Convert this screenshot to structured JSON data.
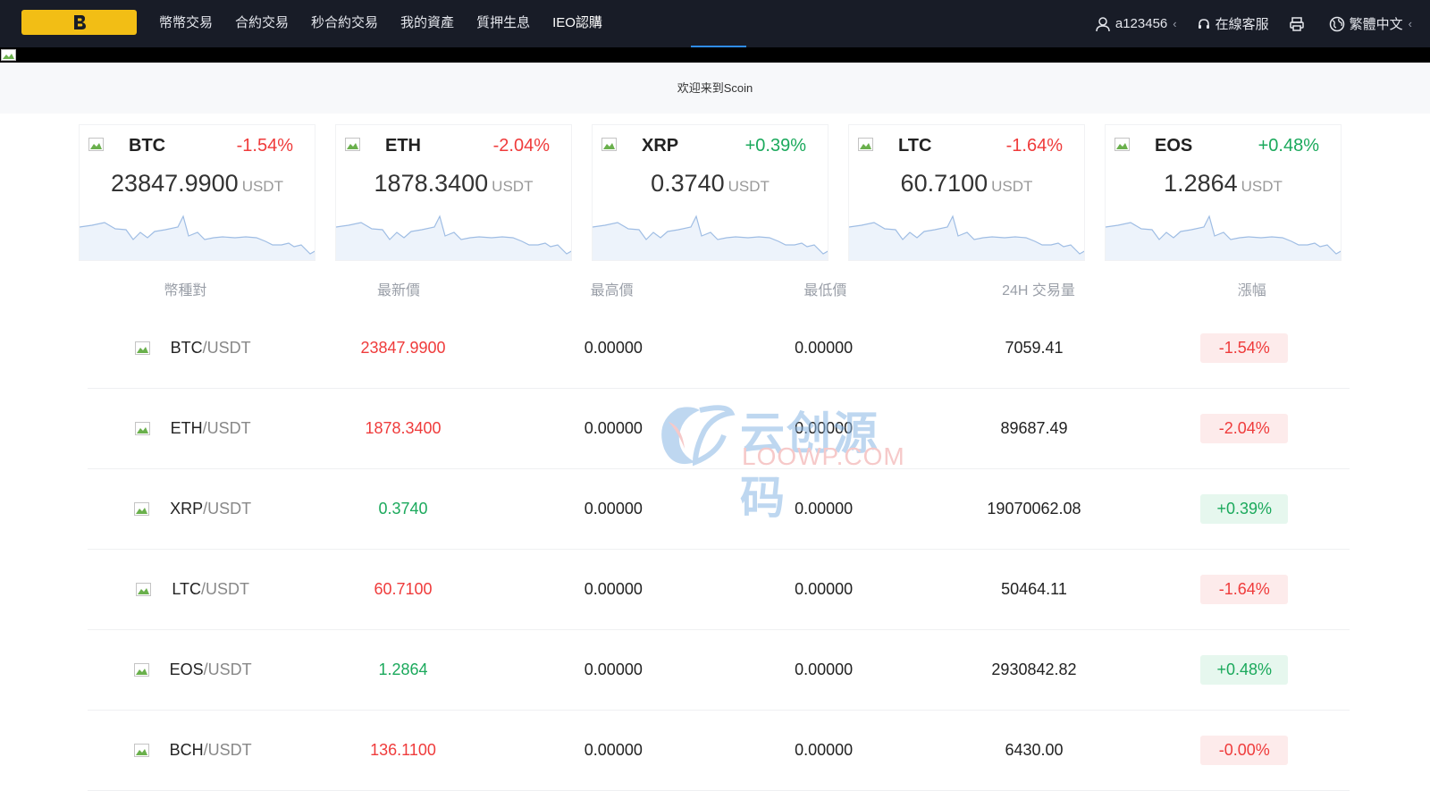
{
  "nav": {
    "logo_letter": "B",
    "items": [
      {
        "label": "幣幣交易"
      },
      {
        "label": "合約交易"
      },
      {
        "label": "秒合約交易"
      },
      {
        "label": "我的資產"
      },
      {
        "label": "質押生息"
      },
      {
        "label": "IEO認購"
      }
    ],
    "user": "a123456",
    "support": "在線客服",
    "language": "繁體中文"
  },
  "banner": {
    "welcome": "欢迎来到Scoin"
  },
  "colors": {
    "up": "#1ba95c",
    "down": "#ef3b3b",
    "accent": "#f2be15",
    "nav_bg": "#181c27"
  },
  "tickers": [
    {
      "symbol": "BTC",
      "change": "-1.54%",
      "price": "23847.9900",
      "unit": "USDT",
      "trend": "down"
    },
    {
      "symbol": "ETH",
      "change": "-2.04%",
      "price": "1878.3400",
      "unit": "USDT",
      "trend": "down"
    },
    {
      "symbol": "XRP",
      "change": "+0.39%",
      "price": "0.3740",
      "unit": "USDT",
      "trend": "up"
    },
    {
      "symbol": "LTC",
      "change": "-1.64%",
      "price": "60.7100",
      "unit": "USDT",
      "trend": "down"
    },
    {
      "symbol": "EOS",
      "change": "+0.48%",
      "price": "1.2864",
      "unit": "USDT",
      "trend": "up"
    }
  ],
  "table": {
    "headers": [
      "幣種對",
      "最新價",
      "最高價",
      "最低價",
      "24H 交易量",
      "漲幅"
    ],
    "rows": [
      {
        "base": "BTC",
        "quote": "/USDT",
        "price": "23847.9900",
        "high": "0.00000",
        "low": "0.00000",
        "volume": "7059.41",
        "change": "-1.54%",
        "trend": "down"
      },
      {
        "base": "ETH",
        "quote": "/USDT",
        "price": "1878.3400",
        "high": "0.00000",
        "low": "0.00000",
        "volume": "89687.49",
        "change": "-2.04%",
        "trend": "down"
      },
      {
        "base": "XRP",
        "quote": "/USDT",
        "price": "0.3740",
        "high": "0.00000",
        "low": "0.00000",
        "volume": "19070062.08",
        "change": "+0.39%",
        "trend": "up"
      },
      {
        "base": "LTC",
        "quote": "/USDT",
        "price": "60.7100",
        "high": "0.00000",
        "low": "0.00000",
        "volume": "50464.11",
        "change": "-1.64%",
        "trend": "down"
      },
      {
        "base": "EOS",
        "quote": "/USDT",
        "price": "1.2864",
        "high": "0.00000",
        "low": "0.00000",
        "volume": "2930842.82",
        "change": "+0.48%",
        "trend": "up"
      },
      {
        "base": "BCH",
        "quote": "/USDT",
        "price": "136.1100",
        "high": "0.00000",
        "low": "0.00000",
        "volume": "6430.00",
        "change": "-0.00%",
        "trend": "down"
      }
    ]
  },
  "watermark": {
    "cn": "云创源码",
    "en": "LOOWP.COM"
  }
}
